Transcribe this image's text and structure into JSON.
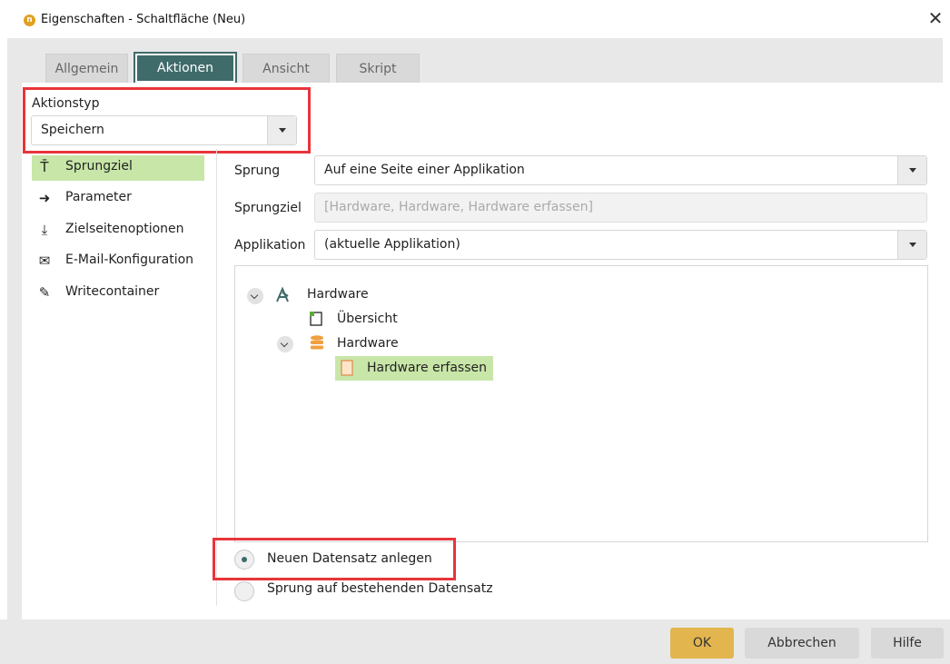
{
  "window": {
    "app_icon_glyph": "n",
    "title": "Eigenschaften - Schaltfläche (Neu)",
    "close_glyph": "✕"
  },
  "tabs": [
    {
      "label": "Allgemein",
      "active": false
    },
    {
      "label": "Aktionen",
      "active": true
    },
    {
      "label": "Ansicht",
      "active": false
    },
    {
      "label": "Skript",
      "active": false
    }
  ],
  "action_type": {
    "label": "Aktionstyp",
    "value": "Speichern"
  },
  "nav": [
    {
      "label": "Sprungziel",
      "icon": "jump-target-icon",
      "glyph": "T̄",
      "active": true
    },
    {
      "label": "Parameter",
      "icon": "arrow-right-icon",
      "glyph": "➜",
      "active": false
    },
    {
      "label": "Zielseitenoptionen",
      "icon": "download-icon",
      "glyph": "⤓",
      "active": false
    },
    {
      "label": "E-Mail-Konfiguration",
      "icon": "envelope-icon",
      "glyph": "✉",
      "active": false
    },
    {
      "label": "Writecontainer",
      "icon": "pencil-icon",
      "glyph": "✎",
      "active": false
    }
  ],
  "form": {
    "sprung_label": "Sprung",
    "sprung_value": "Auf eine Seite einer Applikation",
    "sprungziel_label": "Sprungziel",
    "sprungziel_value": "[Hardware, Hardware, Hardware erfassen]",
    "applikation_label": "Applikation",
    "applikation_value": "(aktuelle Applikation)"
  },
  "tree": {
    "root_label": "Hardware",
    "overview_label": "Übersicht",
    "datagroup_label": "Hardware",
    "selected_page_label": "Hardware erfassen"
  },
  "radio": {
    "option1_label": "Neuen Datensatz anlegen",
    "option1_checked": true,
    "option2_label": "Sprung auf bestehenden Datensatz",
    "option2_checked": false
  },
  "buttons": {
    "ok": "OK",
    "cancel": "Abbrechen",
    "help": "Hilfe"
  },
  "colors": {
    "accent_teal": "#3f6b6a",
    "highlight_green": "#c8e6a8",
    "annotation_red": "#e8353b",
    "ok_button": "#e2b54e"
  }
}
